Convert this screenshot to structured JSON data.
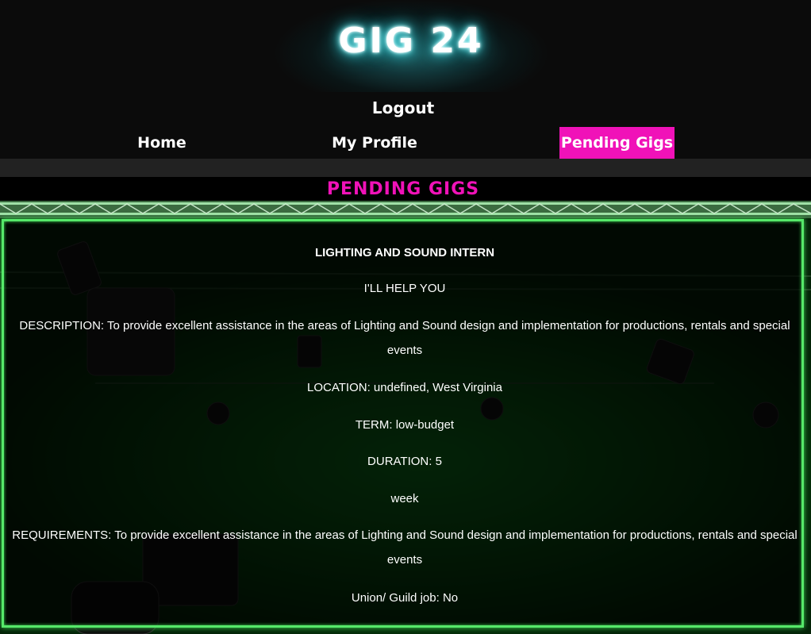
{
  "header": {
    "logo_text": "GIG 24",
    "logout_label": "Logout"
  },
  "nav": {
    "items": [
      {
        "label": "Home",
        "active": false
      },
      {
        "label": "My Profile",
        "active": false
      },
      {
        "label": "Pending Gigs",
        "active": true
      }
    ],
    "active_color": "#f012b8"
  },
  "section": {
    "title": "PENDING GIGS",
    "title_color": "#f012b8"
  },
  "gig": {
    "title": "LIGHTING AND SOUND INTERN",
    "subtitle": "I'LL HELP YOU",
    "description_label": "DESCRIPTION:",
    "description": "To provide excellent assistance in the areas of Lighting and Sound design and implementation for productions, rentals and special events",
    "location_label": "LOCATION:",
    "location": "undefined, West Virginia",
    "term_label": "TERM:",
    "term": "low-budget",
    "duration_label": "DURATION:",
    "duration": "5",
    "duration_unit": "week",
    "requirements_label": "REQUIREMENTS:",
    "requirements": "To provide excellent assistance in the areas of Lighting and Sound design and implementation for productions, rentals and special events",
    "union_label": "Union/ Guild job:",
    "union": "No"
  },
  "colors": {
    "card_border": "#56e86a",
    "logo_glow": "#3ce6ef",
    "page_background": "#0b0b0b"
  },
  "icons": [
    "stage-light-icon",
    "truss-icon"
  ]
}
